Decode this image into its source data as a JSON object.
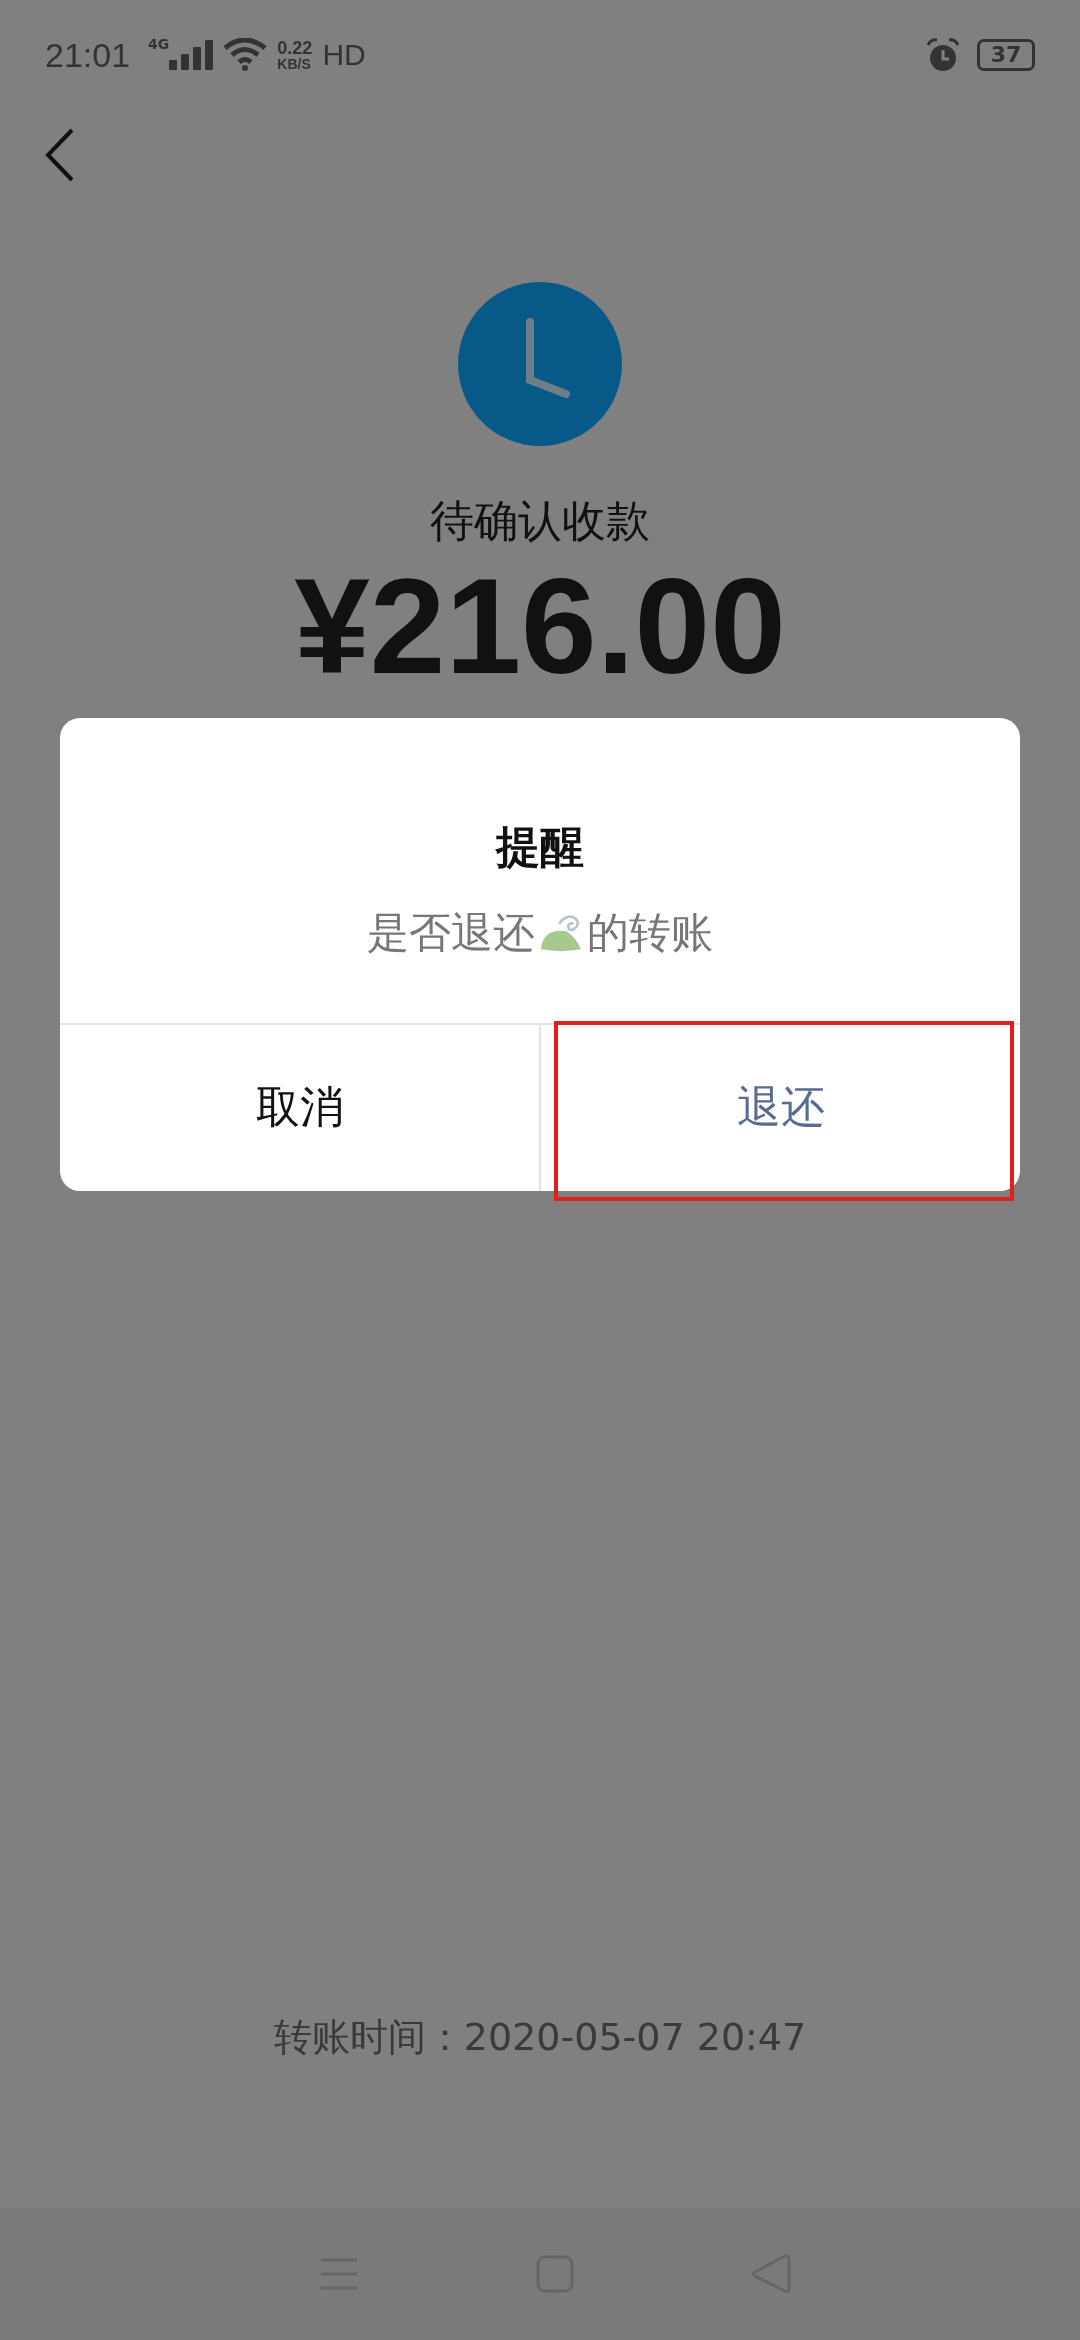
{
  "status_bar": {
    "time": "21:01",
    "network": "4G",
    "speed_value": "0.22",
    "speed_unit": "KB/S",
    "hd": "HD",
    "battery": "37"
  },
  "payment": {
    "status": "待确认收款",
    "amount": "¥216.00",
    "transfer_time": "转账时间：2020-05-07 20:47"
  },
  "dialog": {
    "title": "提醒",
    "message_before": "是否退还",
    "message_after": "的转账",
    "buttons": [
      {
        "label": "取消",
        "kind": "cancel",
        "highlighted": false
      },
      {
        "label": "退还",
        "kind": "confirm",
        "highlighted": true
      }
    ]
  }
}
